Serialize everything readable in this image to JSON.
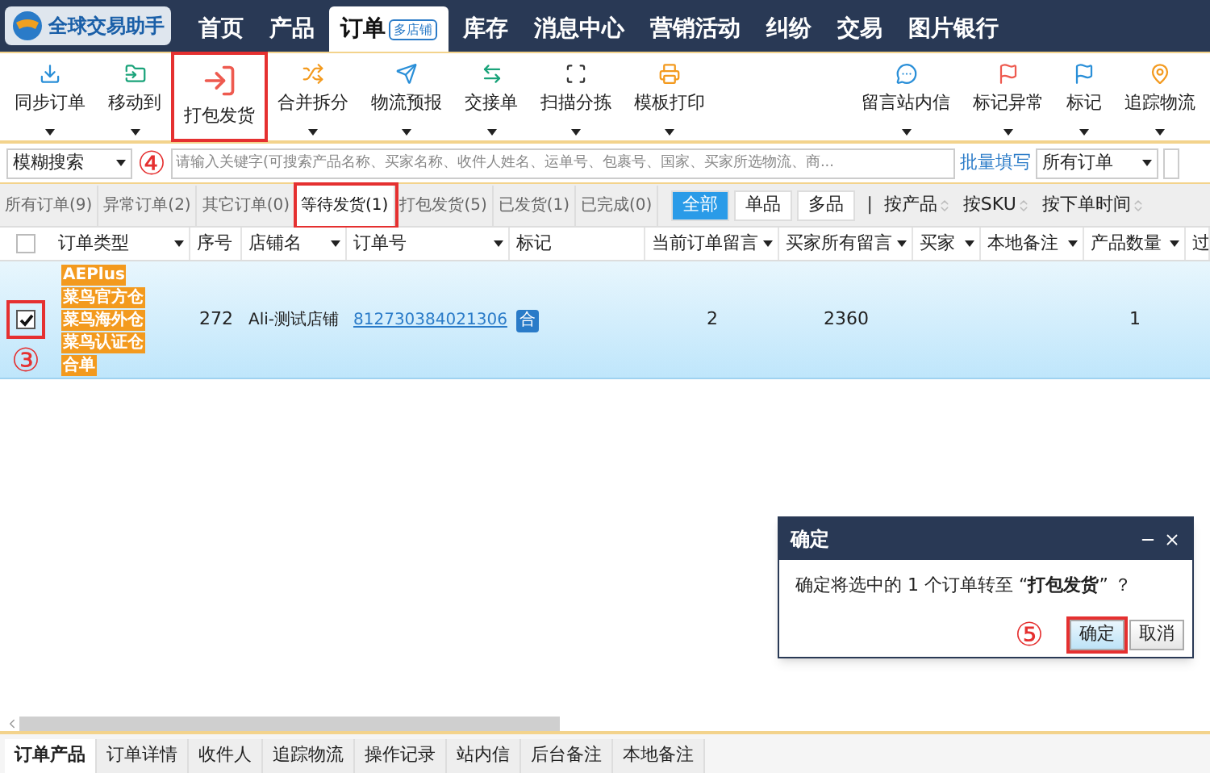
{
  "app": {
    "name": "全球交易助手"
  },
  "nav": [
    {
      "label": "首页",
      "selected": false
    },
    {
      "label": "产品",
      "selected": false
    },
    {
      "label": "订单",
      "selected": true,
      "badge": "多店铺"
    },
    {
      "label": "库存",
      "selected": false
    },
    {
      "label": "消息中心",
      "selected": false
    },
    {
      "label": "营销活动",
      "selected": false
    },
    {
      "label": "纠纷",
      "selected": false
    },
    {
      "label": "交易",
      "selected": false
    },
    {
      "label": "图片银行",
      "selected": false
    }
  ],
  "toolbar_left": [
    {
      "label": "同步订单",
      "has_menu": true,
      "highlighted": false
    },
    {
      "label": "移动到",
      "has_menu": true,
      "highlighted": false
    },
    {
      "label": "打包发货",
      "has_menu": false,
      "highlighted": true
    },
    {
      "label": "合并拆分",
      "has_menu": true,
      "highlighted": false
    },
    {
      "label": "物流预报",
      "has_menu": true,
      "highlighted": false
    },
    {
      "label": "交接单",
      "has_menu": true,
      "highlighted": false
    },
    {
      "label": "扫描分拣",
      "has_menu": true,
      "highlighted": false
    },
    {
      "label": "模板打印",
      "has_menu": true,
      "highlighted": false
    }
  ],
  "toolbar_right": [
    {
      "label": "留言站内信",
      "has_menu": true,
      "highlighted": false
    },
    {
      "label": "标记异常",
      "has_menu": true,
      "highlighted": false
    },
    {
      "label": "标记",
      "has_menu": true,
      "highlighted": false
    },
    {
      "label": "追踪物流",
      "has_menu": true,
      "highlighted": false
    }
  ],
  "search": {
    "mode": "模糊搜索",
    "placeholder": "请输入关键字(可搜索产品名称、买家名称、收件人姓名、运单号、包裹号、国家、买家所选物流、商...",
    "batch_link": "批量填写",
    "scope": "所有订单"
  },
  "status_tabs": [
    {
      "label": "所有订单(9)",
      "selected": false,
      "highlighted": false
    },
    {
      "label": "异常订单(2)",
      "selected": false,
      "highlighted": false
    },
    {
      "label": "其它订单(0)",
      "selected": false,
      "highlighted": false
    },
    {
      "label": "等待发货(1)",
      "selected": true,
      "highlighted": true
    },
    {
      "label": "打包发货(5)",
      "selected": false,
      "highlighted": false
    },
    {
      "label": "已发货(1)",
      "selected": false,
      "highlighted": false
    },
    {
      "label": "已完成(0)",
      "selected": false,
      "highlighted": false
    }
  ],
  "filters": [
    {
      "label": "全部",
      "selected": true
    },
    {
      "label": "单品",
      "selected": false
    },
    {
      "label": "多品",
      "selected": false
    }
  ],
  "separator": "|",
  "sorts": [
    "按产品",
    "按SKU",
    "按下单时间"
  ],
  "table": {
    "all_checked": false,
    "columns": [
      {
        "label": "订单类型",
        "menu": true
      },
      {
        "label": "序号",
        "menu": false
      },
      {
        "label": "店铺名",
        "menu": true
      },
      {
        "label": "订单号",
        "menu": true
      },
      {
        "label": "标记",
        "menu": false
      },
      {
        "label": "当前订单留言",
        "menu": true
      },
      {
        "label": "买家所有留言",
        "menu": true
      },
      {
        "label": "买家",
        "menu": true
      },
      {
        "label": "本地备注",
        "menu": true
      },
      {
        "label": "产品数量",
        "menu": true
      },
      {
        "label": "过"
      }
    ],
    "rows": [
      {
        "checked": true,
        "highlighted": true,
        "types": [
          "AEPlus",
          "菜鸟官方仓",
          "菜鸟海外仓",
          "菜鸟认证仓",
          "合单"
        ],
        "number": "272",
        "shop": "Ali-测试店铺",
        "order_no": "812730384021306",
        "mark": "合",
        "current_msgs": "2",
        "all_msgs": "2360",
        "qty": "1"
      }
    ]
  },
  "bottom_tabs": [
    {
      "label": "订单产品",
      "selected": true
    },
    {
      "label": "订单详情",
      "selected": false
    },
    {
      "label": "收件人",
      "selected": false
    },
    {
      "label": "追踪物流",
      "selected": false
    },
    {
      "label": "操作记录",
      "selected": false
    },
    {
      "label": "站内信",
      "selected": false
    },
    {
      "label": "后台备注",
      "selected": false
    },
    {
      "label": "本地备注",
      "selected": false
    }
  ],
  "dialog": {
    "title": "确定",
    "message": "确定将选中的 1 个订单转至 “**打包发货**” ？",
    "buttons": [
      {
        "label": "确定",
        "primary": true,
        "highlighted": true
      },
      {
        "label": "取消",
        "primary": false,
        "highlighted": false
      }
    ]
  },
  "annotations": [
    "④",
    "③",
    "⑤"
  ]
}
